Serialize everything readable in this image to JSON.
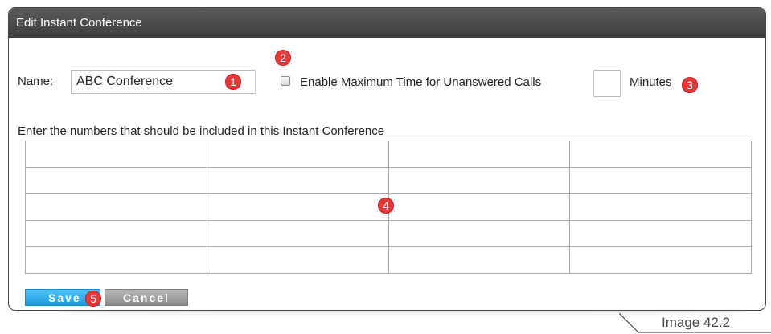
{
  "dialog": {
    "title": "Edit Instant Conference",
    "name_label": "Name:",
    "name_value": "ABC Conference",
    "checkbox_label": "Enable Maximum Time for Unanswered Calls",
    "checkbox_checked": false,
    "minutes_value": "",
    "minutes_label": "Minutes",
    "instructions": "Enter the numbers that should be included in this Instant Conference",
    "grid": {
      "rows": 5,
      "columns": 4
    },
    "save_label": "Save",
    "cancel_label": "Cancel"
  },
  "badges": {
    "b1": "1",
    "b2": "2",
    "b3": "3",
    "b4": "4",
    "b5": "5"
  },
  "caption": "Image 42.2",
  "colors": {
    "titlebar": "#4a4a4a",
    "badge": "#e5383b",
    "save_button": "#2aa9ec",
    "cancel_button": "#a0a0a0"
  }
}
